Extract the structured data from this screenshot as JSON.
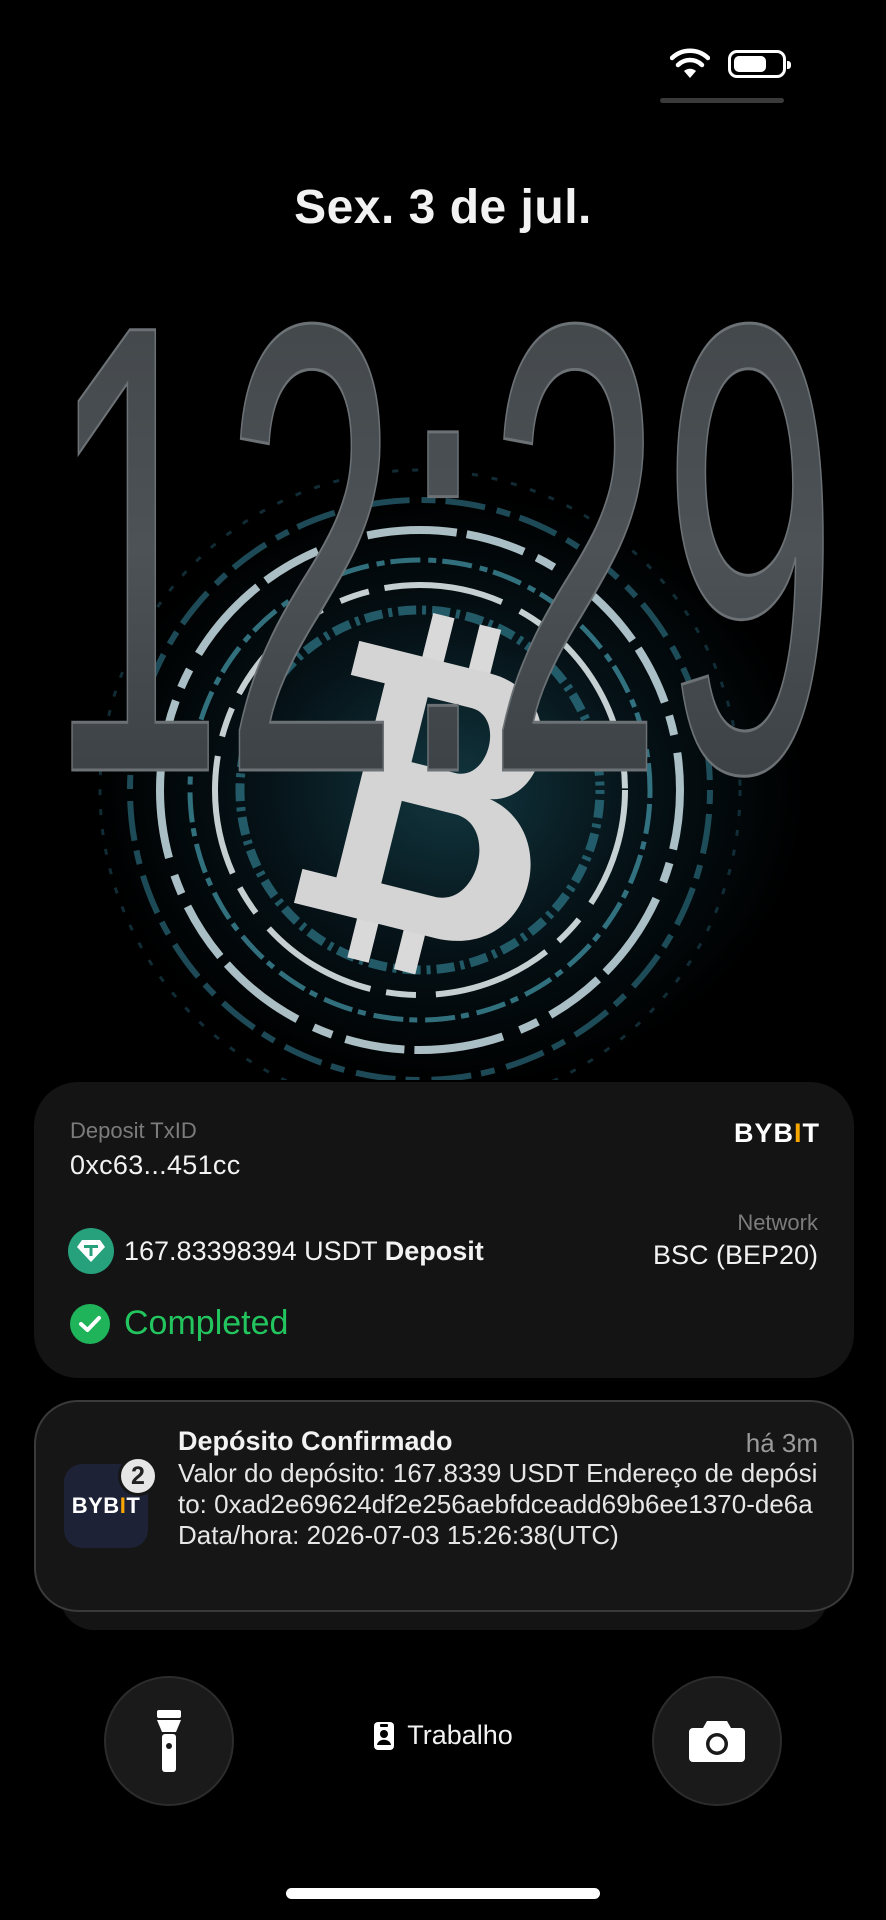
{
  "lockscreen": {
    "date": "Sex. 3 de jul.",
    "time": "12:29"
  },
  "status_bar": {
    "icons": [
      "wifi-icon",
      "battery-icon"
    ],
    "battery_level": 0.7
  },
  "deposit_card": {
    "txid_label": "Deposit TxID",
    "txid_value": "0xc63...451cc",
    "brand": "BYB",
    "brand_i": "I",
    "brand_end": "T",
    "amount": "167.83398394 USDT",
    "amount_suffix": "Deposit",
    "network_label": "Network",
    "network_value": "BSC (BEP20)",
    "status": "Completed",
    "status_color": "#22c55e"
  },
  "notification": {
    "app_icon_text": "BYB",
    "app_icon_i": "I",
    "app_icon_end": "T",
    "badge_count": "2",
    "title": "Depósito Confirmado",
    "time": "há 3m",
    "body": "Valor do depósito: 167.8339 USDT Endereço de depósito: 0xad2e69624df2e256aebfdceadd69b6ee1370-de6a Data/hora: 2026-07-03 15:26:38(UTC)"
  },
  "controls": {
    "focus_label": "Trabalho",
    "left_button": "flashlight-icon",
    "right_button": "camera-icon"
  },
  "colors": {
    "accent_brand": "#f7a600",
    "tether_green": "#26a17b",
    "card_background": "#141414"
  }
}
